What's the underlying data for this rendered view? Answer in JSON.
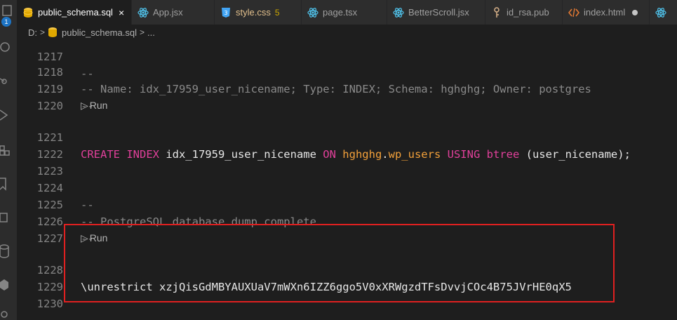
{
  "tabs": [
    {
      "label": "public_schema.sql",
      "icon": "database-icon",
      "active": true,
      "close": "×"
    },
    {
      "label": "App.jsx",
      "icon": "react-icon"
    },
    {
      "label": "style.css",
      "icon": "css-icon",
      "modified": "5"
    },
    {
      "label": "page.tsx",
      "icon": "react-icon"
    },
    {
      "label": "BetterScroll.jsx",
      "icon": "react-icon"
    },
    {
      "label": "id_rsa.pub",
      "icon": "key-icon"
    },
    {
      "label": "index.html",
      "icon": "html-icon",
      "dirty": true
    },
    {
      "label": "",
      "icon": "react-icon"
    }
  ],
  "badge": "1",
  "breadcrumb": {
    "drive": "D:",
    "file": "public_schema.sql",
    "more": "..."
  },
  "codelens": {
    "run1": "Run",
    "run2": "Run"
  },
  "lines": {
    "l1217": {
      "num": "1217",
      "text": "--"
    },
    "l1218": {
      "num": "1218",
      "text": "-- Name: idx_17959_user_nicename; Type: INDEX; Schema: hghghg; Owner: postgres"
    },
    "l1219": {
      "num": "1219",
      "text": "--"
    },
    "l1220": {
      "num": "1220",
      "text": ""
    },
    "l1221": {
      "num": "1221",
      "kw1": "CREATE INDEX",
      "name": " idx_17959_user_nicename ",
      "kw2": "ON",
      "schema": " hghghg",
      "dot": ".",
      "table": "wp_users",
      "kw3": " USING",
      "method": " btree",
      "cols": " (user_nicename);"
    },
    "l1222": {
      "num": "1222",
      "text": ""
    },
    "l1223": {
      "num": "1223",
      "text": ""
    },
    "l1224": {
      "num": "1224",
      "text": "--"
    },
    "l1225": {
      "num": "1225",
      "text": "-- PostgreSQL database dump complete"
    },
    "l1226": {
      "num": "1226",
      "text": "--"
    },
    "l1227": {
      "num": "1227",
      "text": ""
    },
    "l1228": {
      "num": "1228",
      "text": "\\unrestrict xzjQisGdMBYAUXUaV7mWXn6IZZ6ggo5V0xXRWgzdTFsDvvjCOc4B75JVrHE0qX5"
    },
    "l1229": {
      "num": "1229",
      "text": ""
    },
    "l1230": {
      "num": "1230",
      "text": ""
    }
  },
  "colors": {
    "highlight_border": "#e02020",
    "keyword": "#e0409a",
    "comment": "#8a8a8a",
    "identifier_orange": "#f2a03a"
  }
}
